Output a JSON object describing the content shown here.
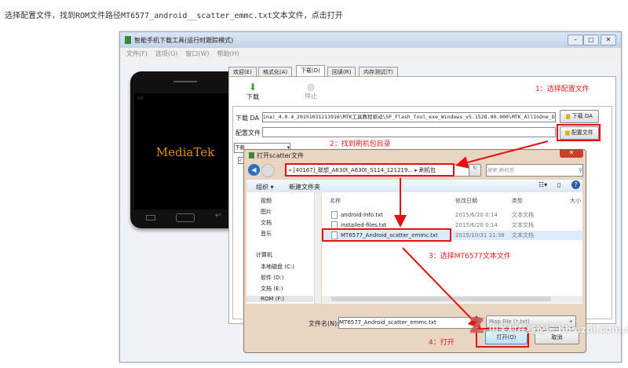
{
  "caption": "选择配置文件，找到ROM文件路径MT6577_android__scatter_emmc.txt文本文件，点击打开",
  "window": {
    "title": "智能手机下载工具(运行时跟踪模式)",
    "menu": [
      "文件(F)",
      "选项(O)",
      "窗口(W)",
      "帮助(H)"
    ]
  },
  "phone": {
    "brand": "MediaTek",
    "corner": "BM"
  },
  "tabs": [
    "欢迎(E)",
    "格式化(A)",
    "下载(D)",
    "回读(R)",
    "内存测试(T)"
  ],
  "active_tab": "下载(D)",
  "toolbar": {
    "download": "下载",
    "stop": "停止"
  },
  "da": {
    "label": "下载 DA",
    "value": "ina)_4.0.4_20151031213916\\MTK工具教程驱动\\SF_Flash_Tool_exe_Windows_v5.1528.00.000\\MTK_AllInOne_DA.bin",
    "button": "下载 DA"
  },
  "config": {
    "label": "配置文件",
    "value": "",
    "button": "配置文件"
  },
  "mode_select": "下载",
  "annotations": {
    "step1": "1：选择配置文件",
    "step2": "2：找到刷机包目录",
    "step3": "3：选择MT6577文本文件",
    "step4": "4：打开"
  },
  "dialog": {
    "title": "打开scatter文件",
    "path": [
      "«",
      "[40167]_联想_A630t_A630t_S114_121219...",
      "▸",
      "刷机包"
    ],
    "search_placeholder": "搜索 刷机包",
    "organize": "组织 ▾",
    "new_folder": "新建文件夹",
    "nav": [
      "视频",
      "图片",
      "文档",
      "音乐",
      "计算机",
      "本地磁盘 (C:)",
      "软件 (D:)",
      "文档 (E:)",
      "ROM (F:)"
    ],
    "columns": [
      "名称",
      "修改日期",
      "类型",
      "大小"
    ],
    "files": [
      {
        "name": "android-info.txt",
        "date": "2015/6/20 0:14",
        "type": "文本文档"
      },
      {
        "name": "installed-files.txt",
        "date": "2015/6/20 0:14",
        "type": "文本文档"
      },
      {
        "name": "MT6577_Android_scatter_emmc.txt",
        "date": "2015/10/31 21:38",
        "type": "文本文档"
      }
    ],
    "filename_label": "文件名(N):",
    "filename": "MT6577_Android_scatter_emmc.txt",
    "filetype": "Map File (*.txt)",
    "open": "打开(O)",
    "cancel": "取消"
  },
  "watermark": "中关村在线论坛 bbs.zol.com.cn"
}
